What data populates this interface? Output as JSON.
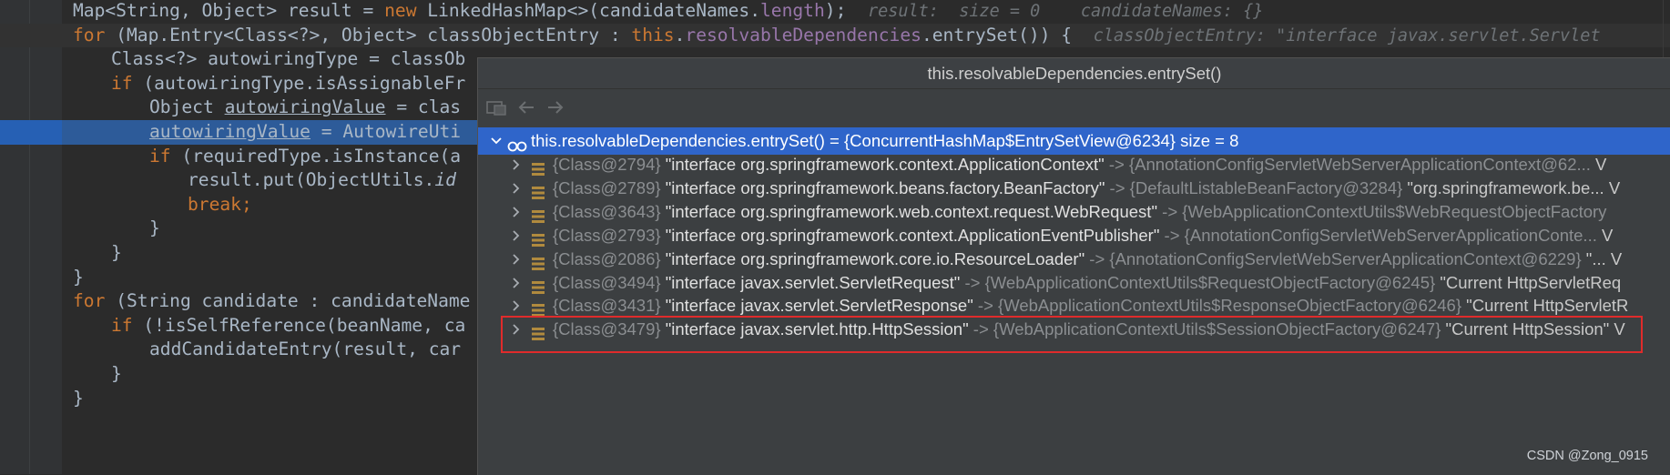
{
  "editor": {
    "lines": [
      {
        "segments": [
          [
            "t",
            "Map<String, Object> result = "
          ],
          [
            "kw",
            "new "
          ],
          [
            "t",
            "LinkedHashMap<>(candidateNames."
          ],
          [
            "fld",
            "length"
          ],
          [
            "t",
            ");"
          ]
        ],
        "hint": "result:  size = 0    candidateNames: {}",
        "indent": 1
      },
      {
        "segments": [
          [
            "kw",
            "for "
          ],
          [
            "t",
            "(Map.Entry<Class<?>, Object> classObjectEntry : "
          ],
          [
            "kw",
            "this"
          ],
          [
            "t",
            "."
          ],
          [
            "fld",
            "resolvableDependencies"
          ],
          [
            "t",
            ".entrySet()) {"
          ]
        ],
        "hint": "classObjectEntry: \"interface javax.servlet.Servlet",
        "indent": 1,
        "current": true
      },
      {
        "segments": [
          [
            "t",
            "Class<?> autowiringType = classOb"
          ]
        ],
        "indent": 2
      },
      {
        "segments": [
          [
            "kw",
            "if "
          ],
          [
            "t",
            "(autowiringType.isAssignableFr"
          ]
        ],
        "indent": 2
      },
      {
        "segments": [
          [
            "t",
            "Object "
          ],
          [
            "u",
            "autowiringValue"
          ],
          [
            "t",
            " = clas"
          ]
        ],
        "indent": 3
      },
      {
        "segments": [
          [
            "u",
            "autowiringValue"
          ],
          [
            "t",
            " = AutowireUti"
          ]
        ],
        "indent": 3,
        "exec": true
      },
      {
        "segments": [
          [
            "kw",
            "if "
          ],
          [
            "t",
            "(requiredType.isInstance(a"
          ]
        ],
        "indent": 3
      },
      {
        "segments": [
          [
            "t",
            "result.put(ObjectUtils."
          ],
          [
            "i",
            "id"
          ]
        ],
        "indent": 4
      },
      {
        "segments": [
          [
            "kw",
            "break;"
          ]
        ],
        "indent": 4
      },
      {
        "segments": [
          [
            "t",
            "}"
          ]
        ],
        "indent": 3
      },
      {
        "segments": [
          [
            "t",
            "}"
          ]
        ],
        "indent": 2
      },
      {
        "segments": [
          [
            "t",
            "}"
          ]
        ],
        "indent": 1
      },
      {
        "segments": [
          [
            "kw",
            "for "
          ],
          [
            "t",
            "(String candidate : candidateName"
          ]
        ],
        "indent": 1
      },
      {
        "segments": [
          [
            "kw",
            "if "
          ],
          [
            "t",
            "(!isSelfReference(beanName, ca"
          ]
        ],
        "indent": 2
      },
      {
        "segments": [
          [
            "t",
            "addCandidateEntry(result, car"
          ]
        ],
        "indent": 3
      },
      {
        "segments": [
          [
            "t",
            "}"
          ]
        ],
        "indent": 2
      },
      {
        "segments": [
          [
            "t",
            "}"
          ]
        ],
        "indent": 1
      }
    ]
  },
  "popup": {
    "title": "this.resolvableDependencies.entrySet()",
    "root": {
      "name": "this.resolvableDependencies.entrySet()",
      "eq": " = ",
      "value": "{ConcurrentHashMap$EntrySetView@6234}",
      "size": "  size = 8"
    },
    "entries": [
      {
        "cls": "{Class@2794}",
        "key": "\"interface org.springframework.context.ApplicationContext\"",
        "arrow": " -> ",
        "value": "{AnnotationConfigServletWebServerApplicationContext@62...",
        "tail": " V"
      },
      {
        "cls": "{Class@2789}",
        "key": "\"interface org.springframework.beans.factory.BeanFactory\"",
        "arrow": " -> ",
        "value": "{DefaultListableBeanFactory@3284}",
        "tail": " \"org.springframework.be... V"
      },
      {
        "cls": "{Class@3643}",
        "key": "\"interface org.springframework.web.context.request.WebRequest\"",
        "arrow": " -> ",
        "value": "{WebApplicationContextUtils$WebRequestObjectFactory",
        "tail": ""
      },
      {
        "cls": "{Class@2793}",
        "key": "\"interface org.springframework.context.ApplicationEventPublisher\"",
        "arrow": " -> ",
        "value": "{AnnotationConfigServletWebServerApplicationConte...",
        "tail": " V"
      },
      {
        "cls": "{Class@2086}",
        "key": "\"interface org.springframework.core.io.ResourceLoader\"",
        "arrow": " -> ",
        "value": "{AnnotationConfigServletWebServerApplicationContext@6229}",
        "tail": " \"... V"
      },
      {
        "cls": "{Class@3494}",
        "key": "\"interface javax.servlet.ServletRequest\"",
        "arrow": " -> ",
        "value": "{WebApplicationContextUtils$RequestObjectFactory@6245}",
        "tail": " \"Current HttpServletReq"
      },
      {
        "cls": "{Class@3431}",
        "key": "\"interface javax.servlet.ServletResponse\"",
        "arrow": " -> ",
        "value": "{WebApplicationContextUtils$ResponseObjectFactory@6246}",
        "tail": " \"Current HttpServletR"
      },
      {
        "cls": "{Class@3479}",
        "key": "\"interface javax.servlet.http.HttpSession\"",
        "arrow": " -> ",
        "value": "{WebApplicationContextUtils$SessionObjectFactory@6247}",
        "tail": " \"Current HttpSession\" V"
      }
    ],
    "highlighted_entry_index": 6
  },
  "watermark": "CSDN @Zong_0915",
  "colors": {
    "selection": "#2f65ca",
    "execution_line": "#2d5b99",
    "keyword": "#cc7832",
    "field": "#9876aa",
    "annotation_box": "#e02b2b"
  },
  "icons": {
    "toolbar": [
      "show-types-icon",
      "back-arrow-icon",
      "forward-arrow-icon"
    ],
    "row_icon": "field-entry-icon",
    "root_icon": "watch-glasses-icon"
  }
}
